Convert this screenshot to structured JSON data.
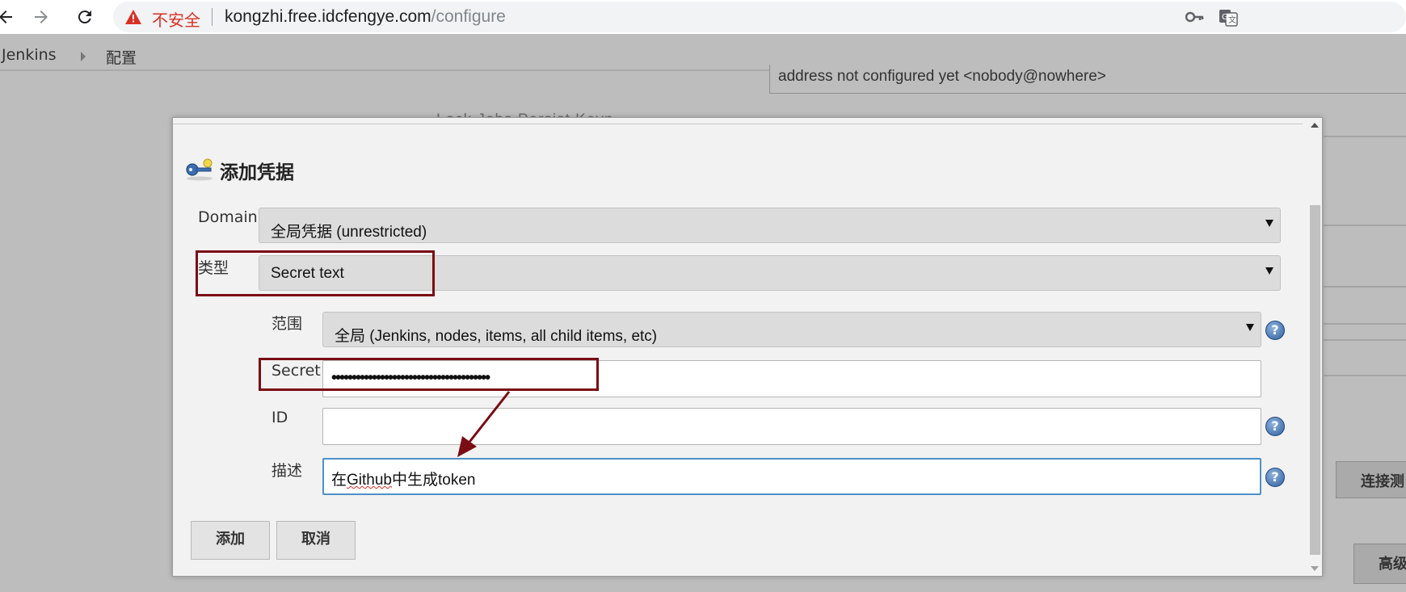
{
  "browser": {
    "insecure_label": "不安全",
    "url_host": "kongzhi.free.idcfengye.com",
    "url_path": "/configure"
  },
  "breadcrumb": {
    "items": [
      "Jenkins",
      "配置"
    ]
  },
  "background": {
    "email_field_value": "address not configured yet <nobody@nowhere>",
    "faded_label": "Lock Jobs Persist Keyn",
    "test_connection_label": "连接测",
    "advanced_label": "高级"
  },
  "dialog": {
    "title": "添加凭据",
    "domain_label": "Domain",
    "domain_value": "全局凭据 (unrestricted)",
    "type_label": "类型",
    "type_value": "Secret text",
    "scope_label": "范围",
    "scope_value": "全局 (Jenkins, nodes, items, all child items, etc)",
    "secret_label": "Secret",
    "secret_value": "•••••••••••••••••••••••••••••••••••••••",
    "id_label": "ID",
    "id_value": "",
    "description_label": "描述",
    "description_prefix": "在",
    "description_misspelled": "Github",
    "description_suffix": "中生成token",
    "help_glyph": "?",
    "add_button": "添加",
    "cancel_button": "取消"
  },
  "colors": {
    "annotation": "#7a0c14",
    "insecure": "#d93025",
    "focus_border": "#4d90c8"
  },
  "icons": [
    "back-arrow-icon",
    "forward-arrow-icon",
    "reload-icon",
    "warning-triangle-icon",
    "key-icon",
    "translate-icon",
    "credentials-key-icon",
    "help-icon"
  ]
}
